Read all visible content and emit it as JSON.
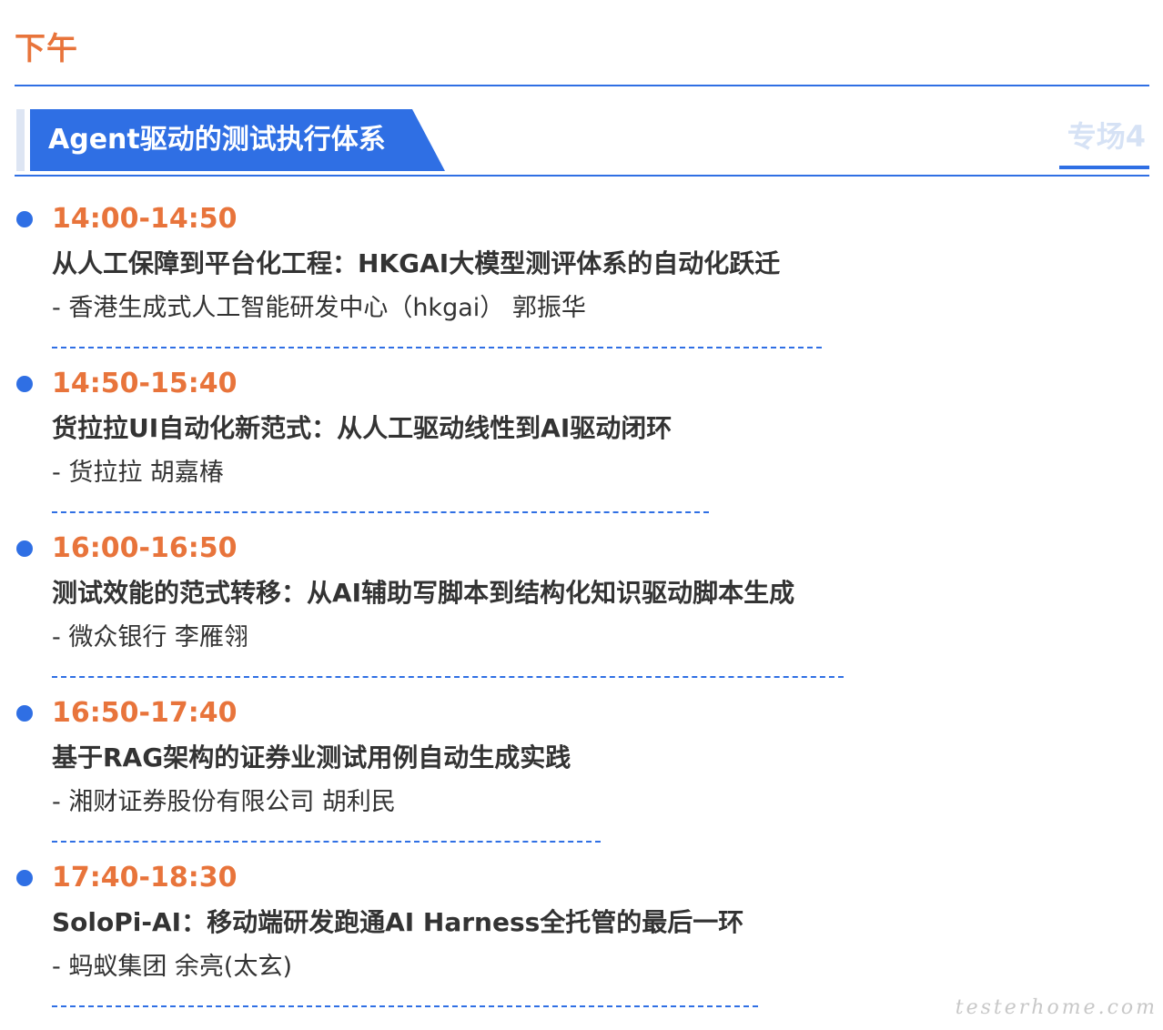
{
  "section": {
    "heading": "下午"
  },
  "track": {
    "title": "Agent驱动的测试执行体系",
    "tag": "专场4"
  },
  "sessions": [
    {
      "time": "14:00-14:50",
      "title": "从人工保障到平台化工程：HKGAI大模型测评体系的自动化跃迁",
      "speaker": "- 香港生成式人工智能研发中心（hkgai）  郭振华"
    },
    {
      "time": "14:50-15:40",
      "title": "货拉拉UI自动化新范式：从人工驱动线性到AI驱动闭环",
      "speaker": "- 货拉拉  胡嘉椿"
    },
    {
      "time": "16:00-16:50",
      "title": "测试效能的范式转移：从AI辅助写脚本到结构化知识驱动脚本生成",
      "speaker": "- 微众银行  李雁翎"
    },
    {
      "time": "16:50-17:40",
      "title": "基于RAG架构的证券业测试用例自动生成实践",
      "speaker": "- 湘财证券股份有限公司  胡利民"
    },
    {
      "time": "17:40-18:30",
      "title": "SoloPi-AI：移动端研发跑通AI Harness全托管的最后一环",
      "speaker": "- 蚂蚁集团  余亮(太玄)"
    }
  ],
  "watermark": {
    "text": "testerhome.com"
  },
  "colors": {
    "accent_blue": "#2f6fe4",
    "accent_orange": "#e8743b",
    "text": "#333333",
    "tag_text": "#d6e2f5"
  }
}
